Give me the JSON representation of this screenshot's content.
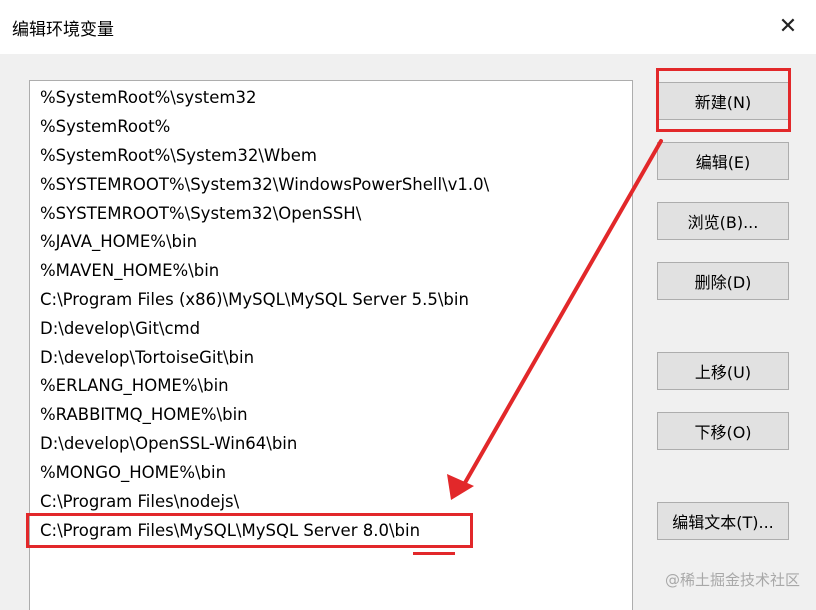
{
  "window": {
    "title": "编辑环境变量",
    "close_glyph": "✕"
  },
  "path_list": {
    "items": [
      "%SystemRoot%\\system32",
      "%SystemRoot%",
      "%SystemRoot%\\System32\\Wbem",
      "%SYSTEMROOT%\\System32\\WindowsPowerShell\\v1.0\\",
      "%SYSTEMROOT%\\System32\\OpenSSH\\",
      "%JAVA_HOME%\\bin",
      "%MAVEN_HOME%\\bin",
      "C:\\Program Files (x86)\\MySQL\\MySQL Server 5.5\\bin",
      "D:\\develop\\Git\\cmd",
      "D:\\develop\\TortoiseGit\\bin",
      "%ERLANG_HOME%\\bin",
      "%RABBITMQ_HOME%\\bin",
      "D:\\develop\\OpenSSL-Win64\\bin",
      "%MONGO_HOME%\\bin",
      "C:\\Program Files\\nodejs\\",
      "C:\\Program Files\\MySQL\\MySQL Server 8.0\\bin"
    ]
  },
  "buttons": {
    "new": "新建(N)",
    "edit": "编辑(E)",
    "browse": "浏览(B)...",
    "delete": "删除(D)",
    "move_up": "上移(U)",
    "move_down": "下移(O)",
    "edit_text": "编辑文本(T)..."
  },
  "annotation": {
    "color": "#e2282a"
  },
  "watermark": {
    "text": "@稀土掘金技术社区"
  }
}
